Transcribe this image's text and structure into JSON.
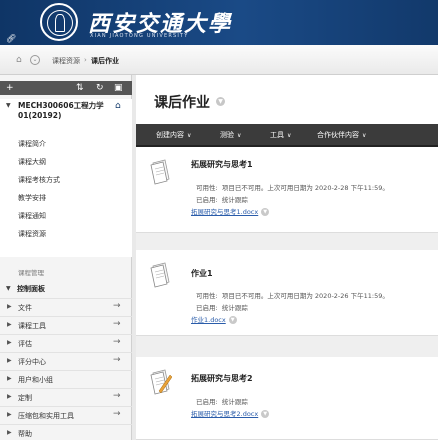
{
  "header": {
    "logo_title": "西安交通大學",
    "logo_subtitle": "XIAN JIAOTONG UNIVERSITY"
  },
  "breadcrumb": {
    "items": [
      "课程资源",
      "课后作业"
    ],
    "separator": "›"
  },
  "sidebar": {
    "toolbar_icons": [
      "add-icon",
      "sort-icon",
      "refresh-icon",
      "folder-icon"
    ],
    "course_title": "MECH300606工程力学01(20192)",
    "menu_items": [
      "课程简介",
      "课程大纲",
      "课程考核方式",
      "教学安排",
      "课程通知",
      "课程资源"
    ],
    "management_label": "课程管理",
    "control_panel": {
      "title": "控制面板",
      "items": [
        "文件",
        "课程工具",
        "评估",
        "评分中心",
        "用户和小组",
        "定制",
        "压缩包和实用工具",
        "帮助"
      ]
    }
  },
  "main": {
    "title": "课后作业",
    "actions": [
      "创建内容",
      "测验",
      "工具",
      "合作伙伴内容"
    ],
    "items": [
      {
        "title": "拓展研究与思考1",
        "availability_label": "可用性:",
        "availability_value": "项目已不可用。上次可用日期为 2020-2-28 下午11:59。",
        "enabled_label": "已启用:",
        "enabled_value": "统计跟踪",
        "attachment": "拓展研究与思考1.docx"
      },
      {
        "title": "作业1",
        "availability_label": "可用性:",
        "availability_value": "项目已不可用。上次可用日期为 2020-2-26 下午11:59。",
        "enabled_label": "已启用:",
        "enabled_value": "统计跟踪",
        "attachment": "作业1.docx"
      },
      {
        "title": "拓展研究与思考2",
        "enabled_label": "已启用:",
        "enabled_value": "统计跟踪",
        "attachment": "拓展研究与思考2.docx"
      }
    ]
  },
  "colors": {
    "header_blue": "#12396b",
    "action_bar": "#3b3b3b",
    "link_blue": "#2a5caa"
  }
}
